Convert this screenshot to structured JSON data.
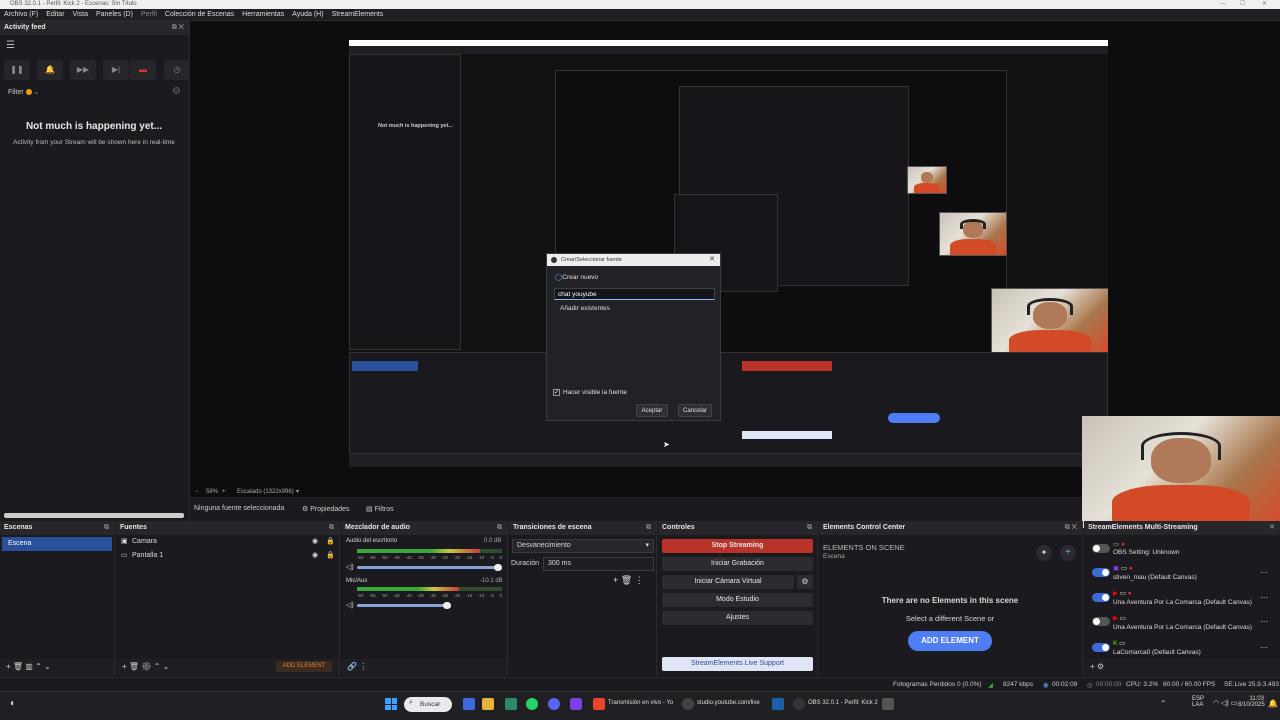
{
  "window": {
    "title": "OBS 32.0.1 - Perfil: Kick 2 - Escenas: Sin Título"
  },
  "menu": [
    "Archivo (F)",
    "Editar",
    "Vista",
    "Paneles (D)",
    "Perfil",
    "Colección de Escenas",
    "Herramientas",
    "Ayuda (H)",
    "StreamElements"
  ],
  "activity": {
    "title": "Activity feed",
    "filter": "Filter",
    "empty_title": "Not much is happening yet...",
    "empty_sub": "Activity from your Stream will be shown here in real-time"
  },
  "dialog": {
    "title": "Crear/Seleccionar fuente",
    "create_new": "Crear nuevo",
    "input_value": "chat youyube",
    "add_existing": "Añadir existentes",
    "visible": "Hacer visible la fuente",
    "ok": "Aceptar",
    "cancel": "Cancelar"
  },
  "preview_zoom": {
    "percent": "58%",
    "scaled": "Escalado (1322x996)"
  },
  "source_bar": {
    "none": "Ninguna fuente seleccionada",
    "properties": "Propiedades",
    "filters": "Filtros"
  },
  "scenes": {
    "title": "Escenas",
    "items": [
      "Escena"
    ]
  },
  "sources": {
    "title": "Fuentes",
    "items": [
      "Camara",
      "Pantalla 1"
    ],
    "add_element": "ADD ELEMENT"
  },
  "mixer": {
    "title": "Mezclador de audio",
    "channels": [
      {
        "name": "Audio del escritorio",
        "db": "0.0 dB",
        "level": 0.85,
        "volume": 1.0
      },
      {
        "name": "Mic/Aux",
        "db": "-10.1 dB",
        "level": 0.7,
        "volume": 0.65
      }
    ],
    "scale": [
      "-60",
      "-55",
      "-50",
      "-45",
      "-40",
      "-35",
      "-30",
      "-25",
      "-20",
      "-15",
      "-10",
      "-5",
      "0"
    ]
  },
  "transitions": {
    "title": "Transiciones de escena",
    "type": "Desvanecimiento",
    "duration_label": "Duración",
    "duration": "300 ms"
  },
  "controls": {
    "title": "Controles",
    "buttons": [
      "Stop Streaming",
      "Iniciar Grabación",
      "Iniciar Cámara Virtual",
      "Modo Estudio",
      "Ajustes"
    ],
    "support": "StreamElements Live Support"
  },
  "elements": {
    "title": "Elements Control Center",
    "on_scene": "ELEMENTS ON SCENE",
    "scene": "Escena",
    "empty": "There are no Elements in this scene",
    "hint": "Select a different Scene or",
    "add": "ADD ELEMENT"
  },
  "multistream": {
    "title": "StreamElements Multi-Streaming",
    "items": [
      {
        "label": "OBS Setting: Unknown",
        "on": false
      },
      {
        "label": "stiven_mau (Default Canvas)",
        "on": true
      },
      {
        "label": "Una Aventura Por La Comarca (Default Canvas)",
        "on": true
      },
      {
        "label": "Una Aventura Por La Comarca (Default Canvas)",
        "on": false
      },
      {
        "label": "LaComarca0 (Default Canvas)",
        "on": true
      }
    ]
  },
  "status": {
    "dropped": "Fotogramas Perdidos 0 (0.0%)",
    "kbps": "8247 kbps",
    "live": "00:02:09",
    "rec": "00:00:00",
    "cpu": "CPU: 3.2%",
    "fps": "60.00 / 60.00 FPS",
    "version": "SE.Live 25.9.3.493"
  },
  "taskbar": {
    "search": "Buscar",
    "apps": [
      "Transmisión en vivo - Yo",
      "studio.youtube.com/live",
      "OBS 32.0.1 - Perfil: Kick 2"
    ],
    "lang": "ESP",
    "lang2": "LAA",
    "time": "11:03",
    "date": "8/10/2025"
  },
  "colors": {
    "accent": "#2a4f9b",
    "stop": "#b9332b",
    "add": "#4f7df3"
  }
}
